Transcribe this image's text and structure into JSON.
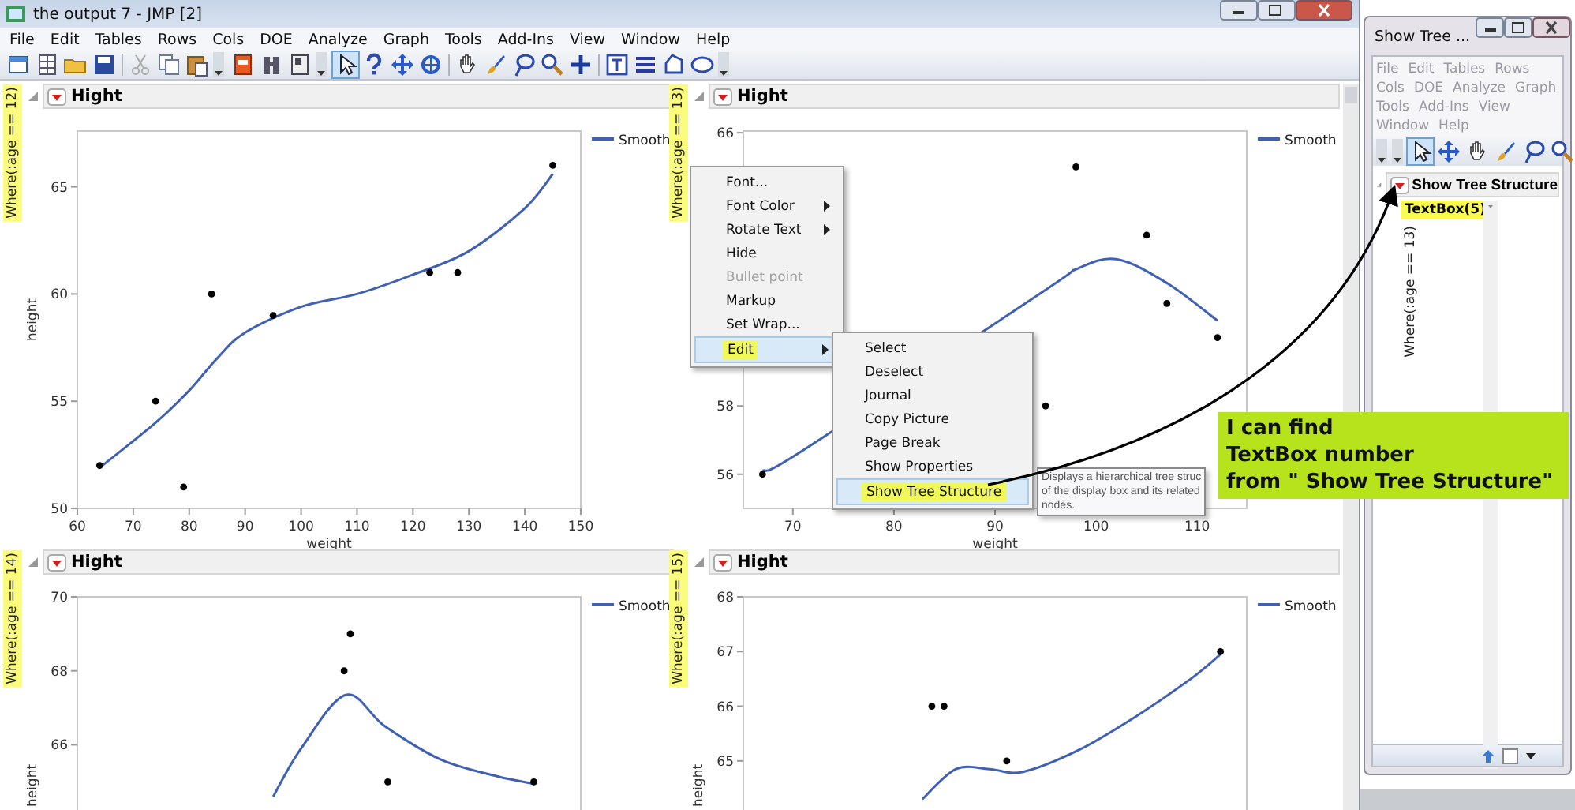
{
  "main_window": {
    "title": "the output 7 - JMP [2]",
    "menu": [
      "File",
      "Edit",
      "Tables",
      "Rows",
      "Cols",
      "DOE",
      "Analyze",
      "Graph",
      "Tools",
      "Add-Ins",
      "View",
      "Window",
      "Help"
    ]
  },
  "panels": [
    {
      "where_label": "Where(:age == 12)",
      "title": "Hight",
      "chart_data": {
        "type": "scatter",
        "xlabel": "weight",
        "ylabel": "height",
        "xlim": [
          60,
          150
        ],
        "ylim": [
          50,
          67.6
        ],
        "xticks": [
          60,
          70,
          80,
          90,
          100,
          110,
          120,
          130,
          140,
          150
        ],
        "yticks": [
          50,
          55,
          60,
          65
        ],
        "series": [
          {
            "name": "Smooth",
            "type": "line",
            "color": "#4060b4",
            "x": [
              64,
              74,
              80,
              85,
              90,
              100,
              110,
              120,
              130,
              140,
              145
            ],
            "values": [
              51.9,
              54,
              55.5,
              57,
              58.2,
              59.4,
              60,
              60.9,
              62,
              64,
              65.6
            ]
          },
          {
            "type": "scatter",
            "color": "#000000",
            "x": [
              64,
              74,
              79,
              84,
              95,
              123,
              128,
              145
            ],
            "values": [
              52,
              55,
              51,
              60,
              59,
              61,
              61,
              66
            ]
          }
        ]
      }
    },
    {
      "where_label": "Where(:age == 13)",
      "title": "Hight",
      "chart_data": {
        "type": "scatter",
        "xlabel": "weight",
        "xlim": [
          65.1,
          114.9
        ],
        "ylim": [
          55,
          66.05
        ],
        "xticks": [
          70,
          80,
          90,
          100,
          110
        ],
        "yticks": [
          56,
          58,
          66
        ],
        "series": [
          {
            "name": "Smooth",
            "type": "line",
            "color": "#4060b4",
            "x": [
              67,
              71,
              95,
              98,
              102,
              107,
              112
            ],
            "values": [
              56.1,
              56.7,
              61.4,
              62.0,
              62.3,
              61.6,
              60.5
            ]
          },
          {
            "type": "scatter",
            "color": "#000000",
            "x": [
              67,
              95,
              98,
              105,
              107,
              112
            ],
            "values": [
              56,
              58,
              65,
              63,
              61,
              60
            ]
          }
        ]
      }
    },
    {
      "where_label": "Where(:age == 14)",
      "title": "Hight",
      "chart_data": {
        "type": "scatter",
        "ylabel": "height",
        "xlim": [
          60,
          150
        ],
        "ylim": [
          59.8,
          70
        ],
        "yticks": [
          66,
          68,
          70
        ],
        "series": [
          {
            "name": "Smooth",
            "type": "line",
            "color": "#4060b4",
            "x": [
              95,
              100,
              108,
              115,
              125,
              135,
              141.6
            ],
            "values": [
              64.6,
              65.9,
              67.35,
              66.5,
              65.6,
              65.15,
              64.95
            ]
          },
          {
            "type": "scatter",
            "color": "#000000",
            "x": [
              107.7,
              108.8,
              115.5,
              141.6
            ],
            "values": [
              68,
              69,
              65,
              65
            ]
          }
        ]
      }
    },
    {
      "where_label": "Where(:age == 15)",
      "title": "Hight",
      "chart_data": {
        "type": "scatter",
        "ylabel": "height",
        "xlim": [
          65.1,
          114.9
        ],
        "ylim": [
          61.1,
          68
        ],
        "yticks": [
          65,
          66,
          67,
          68
        ],
        "series": [
          {
            "name": "Smooth",
            "type": "line",
            "color": "#4060b4",
            "x": [
              82.81,
              86.13,
              89.45,
              92.77,
              98.3,
              103.83,
              109.37,
              112.3
            ],
            "values": [
              64.3,
              64.85,
              64.85,
              64.8,
              65.2,
              65.8,
              66.5,
              66.95
            ]
          },
          {
            "type": "scatter",
            "color": "#000000",
            "x": [
              83.75,
              84.96,
              91.16,
              112.3
            ],
            "values": [
              66,
              66,
              65,
              67
            ]
          }
        ]
      }
    }
  ],
  "context_menu": {
    "items": [
      {
        "label": "Font...",
        "submenu": false,
        "disabled": false,
        "selected": false
      },
      {
        "label": "Font Color",
        "submenu": true,
        "disabled": false,
        "selected": false
      },
      {
        "label": "Rotate Text",
        "submenu": true,
        "disabled": false,
        "selected": false
      },
      {
        "label": "Hide",
        "submenu": false,
        "disabled": false,
        "selected": false
      },
      {
        "label": "Bullet point",
        "submenu": false,
        "disabled": true,
        "selected": false
      },
      {
        "label": "Markup",
        "submenu": false,
        "disabled": false,
        "selected": false
      },
      {
        "label": "Set Wrap...",
        "submenu": false,
        "disabled": false,
        "selected": false
      },
      {
        "label": "Edit",
        "submenu": true,
        "disabled": false,
        "selected": true
      }
    ]
  },
  "edit_submenu": {
    "items": [
      {
        "label": "Select",
        "selected": false
      },
      {
        "label": "Deselect",
        "selected": false
      },
      {
        "label": "Journal",
        "selected": false
      },
      {
        "label": "Copy Picture",
        "selected": false
      },
      {
        "label": "Page Break",
        "selected": false
      },
      {
        "label": "Show Properties",
        "selected": false
      },
      {
        "label": "Show Tree Structure",
        "selected": true
      }
    ]
  },
  "tooltip": {
    "lines": [
      "Displays a hierarchical tree struc",
      "of the display box and its related",
      "nodes."
    ]
  },
  "annotation": {
    "lines": [
      "I can find",
      "TextBox number",
      "from \" Show Tree Structure\""
    ]
  },
  "tree_window": {
    "title": "Show Tree ...",
    "active": false,
    "menu": [
      "File",
      "Edit",
      "Tables",
      "Rows",
      "Cols",
      "DOE",
      "Analyze",
      "Graph",
      "Tools",
      "Add-Ins",
      "View",
      "Window",
      "Help"
    ],
    "outline_title": "Show Tree Structure",
    "tree": [
      {
        "label": "TextBox(5)",
        "selected": true
      }
    ],
    "where_label": "Where(:age == 13)"
  }
}
